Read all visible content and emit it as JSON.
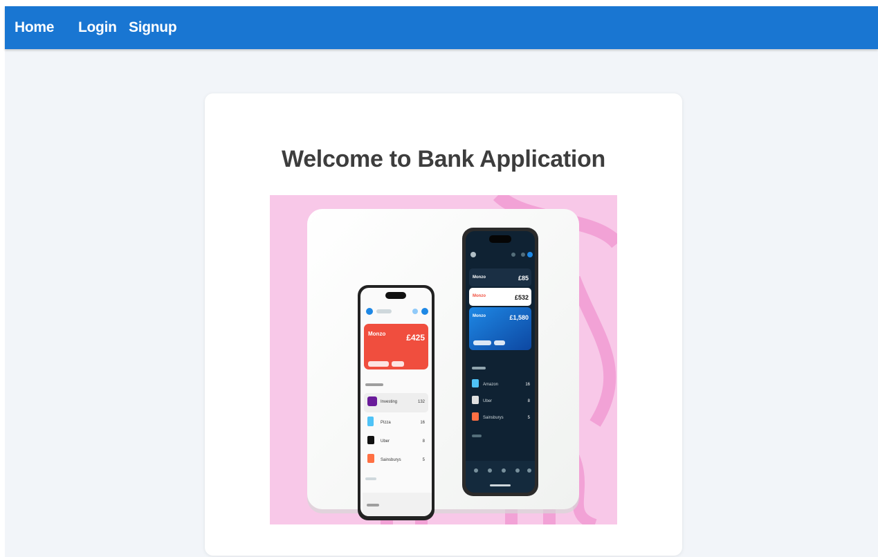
{
  "nav": {
    "home_label": "Home",
    "login_label": "Login",
    "signup_label": "Signup"
  },
  "main": {
    "title": "Welcome to Bank Application",
    "hero_icon": "banking-app-phones-image"
  },
  "phones": {
    "light": {
      "card_brand": "Monzo",
      "card_amount": "£425",
      "transactions": [
        "Investing",
        "Pizza",
        "Uber",
        "Sainsburys"
      ],
      "amounts": [
        "132",
        "16",
        "8",
        "5"
      ]
    },
    "dark": {
      "cards": [
        {
          "brand": "Monzo",
          "amount": "£85"
        },
        {
          "brand": "Monzo",
          "amount": "£532"
        },
        {
          "brand": "Monzo",
          "amount": "£1,580"
        }
      ],
      "transactions": [
        "Amazon",
        "Uber",
        "Sainsburys"
      ],
      "amounts": [
        "16",
        "8",
        "5"
      ]
    }
  },
  "colors": {
    "nav_bg": "#1976d2",
    "page_bg": "#f2f5f9",
    "hero_bg": "#f8c8e8",
    "light_card": "#f04e3e",
    "dark_card": "#1565c0"
  }
}
